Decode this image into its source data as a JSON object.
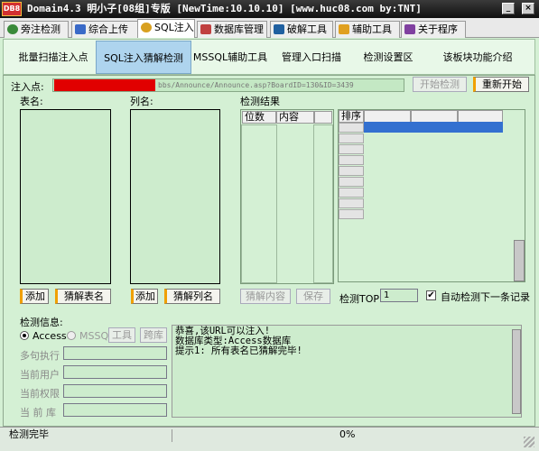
{
  "title": "Domain4.3 明小子[08组]专版 [NewTime:10.10.10] [www.huc08.com by:TNT]",
  "logo": "DB8",
  "tabs": [
    {
      "label": "旁注检测",
      "icon": "globe-icon",
      "color": "#3a8a3a"
    },
    {
      "label": "综合上传",
      "icon": "upload-icon",
      "color": "#3a6ac8"
    },
    {
      "label": "SQL注入",
      "icon": "magnifier-icon",
      "color": "#d8a020"
    },
    {
      "label": "数据库管理",
      "icon": "database-icon",
      "color": "#c04040"
    },
    {
      "label": "破解工具",
      "icon": "tool-icon",
      "color": "#2060a0"
    },
    {
      "label": "辅助工具",
      "icon": "book-icon",
      "color": "#e0a020"
    },
    {
      "label": "关于程序",
      "icon": "info-icon",
      "color": "#8040a0"
    }
  ],
  "subnav": [
    "批量扫描注入点",
    "SQL注入猜解检测",
    "MSSQL辅助工具",
    "管理入口扫描",
    "检测设置区",
    "该板块功能介绍"
  ],
  "injection": {
    "label": "注入点:",
    "url": "bbs/Announce/Announce.asp?BoardID=130&ID=3439",
    "start_button": "开始检测",
    "restart_button": "重新开始"
  },
  "tables": {
    "label": "表名:",
    "add": "添加",
    "guess": "猜解表名"
  },
  "columns": {
    "label": "列名:",
    "add": "添加",
    "guess": "猜解列名"
  },
  "results": {
    "label": "检测结果",
    "col1": "位数",
    "col2": "内容",
    "guess_content": "猜解内容",
    "save": "保存",
    "order_header": "排序"
  },
  "detect": {
    "top_label": "检测TOP:",
    "top_value": "1",
    "auto_label": "自动检测下一条记录",
    "auto_checked": true
  },
  "detection_info": {
    "label": "检测信息:",
    "access": "Access",
    "mssql": "MSSQL",
    "tools": "工具",
    "crossdb": "跨库",
    "fields": [
      "多句执行",
      "当前用户",
      "当前权限",
      "当 前 库"
    ]
  },
  "log": [
    "恭喜,该URL可以注入!",
    "数据库类型:Access数据库",
    "提示1: 所有表名已猜解完毕!"
  ],
  "status": {
    "text": "检测完毕",
    "progress": "0%"
  }
}
